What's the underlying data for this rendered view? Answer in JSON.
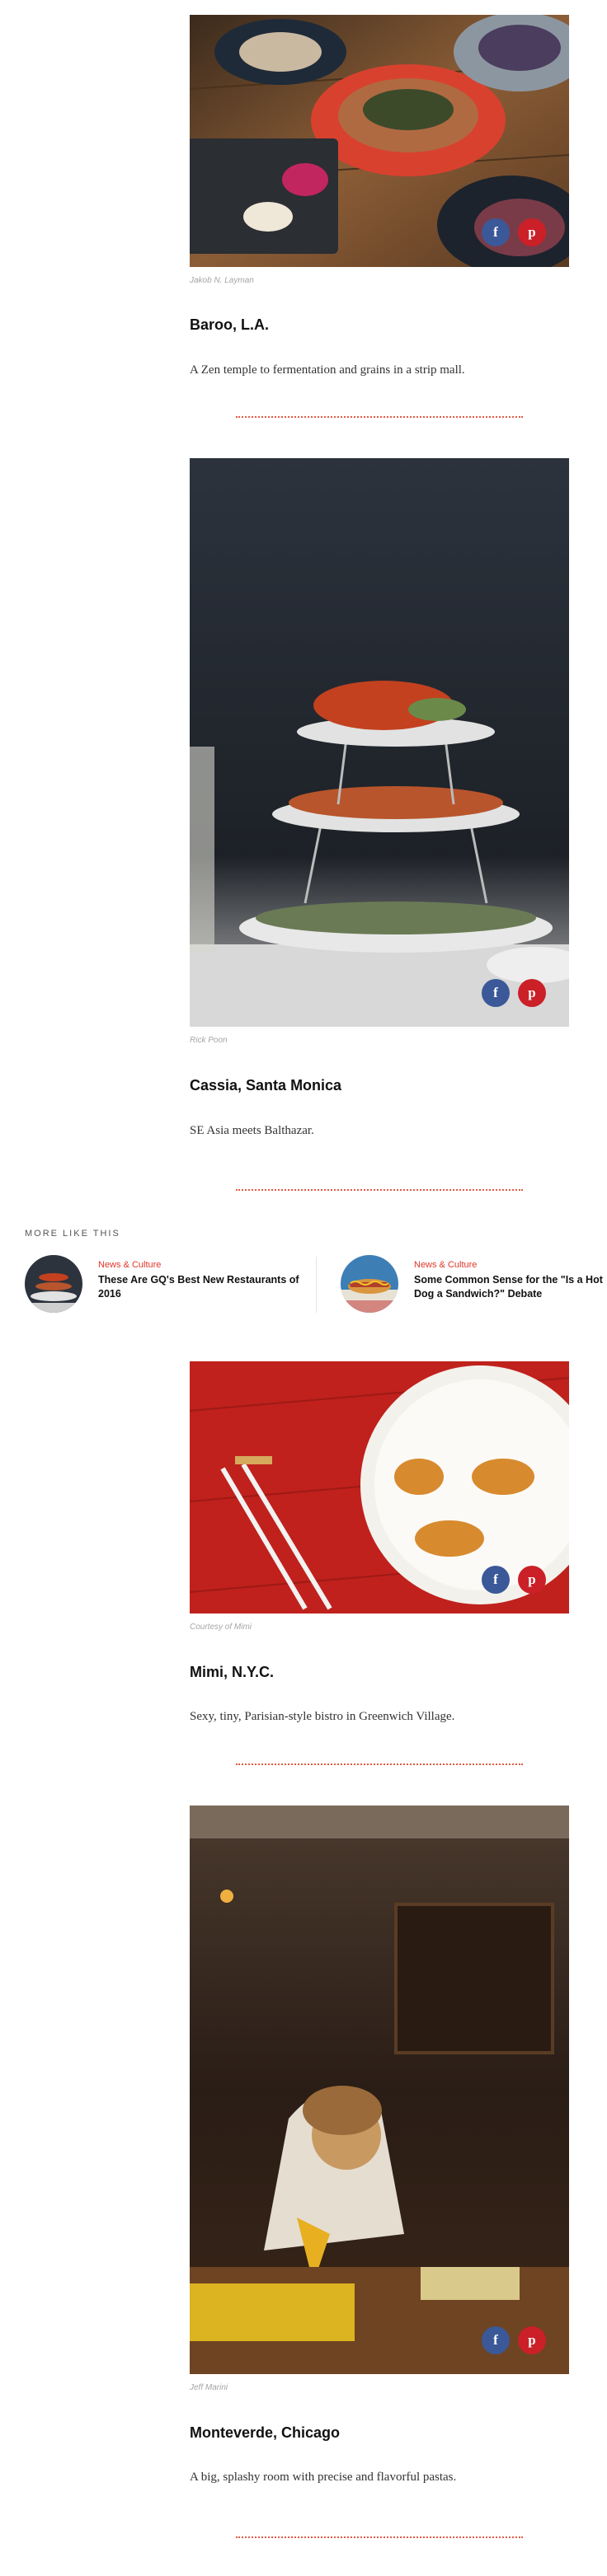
{
  "articles": [
    {
      "credit": "Jakob N. Layman",
      "title": "Baroo, L.A.",
      "description": "A Zen temple to fermentation and grains in a strip mall.",
      "share_fb": "f",
      "share_pin": "p"
    },
    {
      "credit": "Rick Poon",
      "title": "Cassia, Santa Monica",
      "description": "SE Asia meets Balthazar.",
      "share_fb": "f",
      "share_pin": "p"
    },
    {
      "credit": "Courtesy of Mimi",
      "title": "Mimi, N.Y.C.",
      "description": "Sexy, tiny, Parisian-style bistro in Greenwich Village.",
      "share_fb": "f",
      "share_pin": "p"
    },
    {
      "credit": "Jeff Marini",
      "title": "Monteverde, Chicago",
      "description": "A big, splashy room with precise and flavorful pastas.",
      "share_fb": "f",
      "share_pin": "p"
    }
  ],
  "more_like_this": {
    "heading": "MORE LIKE THIS",
    "items": [
      {
        "category": "News & Culture",
        "title": "These Are GQ's Best New Restaurants of 2016"
      },
      {
        "category": "News & Culture",
        "title": "Some Common Sense for the \"Is a Hot Dog a Sandwich?\" Debate"
      }
    ]
  },
  "colors": {
    "facebook": "#3b5998",
    "pinterest": "#cb2027",
    "accent": "#e0352a",
    "divider": "#e25a45"
  },
  "icons": [
    "facebook-icon",
    "pinterest-icon"
  ]
}
